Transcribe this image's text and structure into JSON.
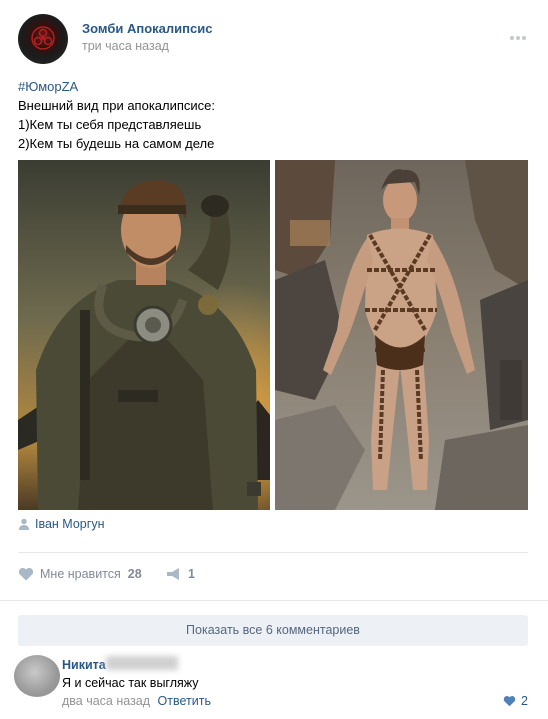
{
  "post": {
    "author": "Зомби Апокалипсис",
    "time": "три часа назад",
    "hashtag": "#ЮморZA",
    "lines": [
      "Внешний вид при апокалипсисе:",
      "1)Кем ты себя представляешь",
      "2)Кем ты будешь на самом деле"
    ],
    "signer": "Іван Моргун"
  },
  "actions": {
    "like_label": "Мне нравится",
    "like_count": "28",
    "share_count": "1"
  },
  "comments": {
    "show_all_label": "Показать все 6 комментариев",
    "items": [
      {
        "author": "Никита",
        "text": "Я и сейчас так выгляжу",
        "time": "два часа назад",
        "reply_label": "Ответить",
        "likes": "2"
      }
    ]
  },
  "colors": {
    "link": "#2a5885",
    "muted": "#939393",
    "button_bg": "#edf0f5"
  },
  "icons": [
    "more-icon",
    "person-icon",
    "heart-icon",
    "share-icon"
  ]
}
